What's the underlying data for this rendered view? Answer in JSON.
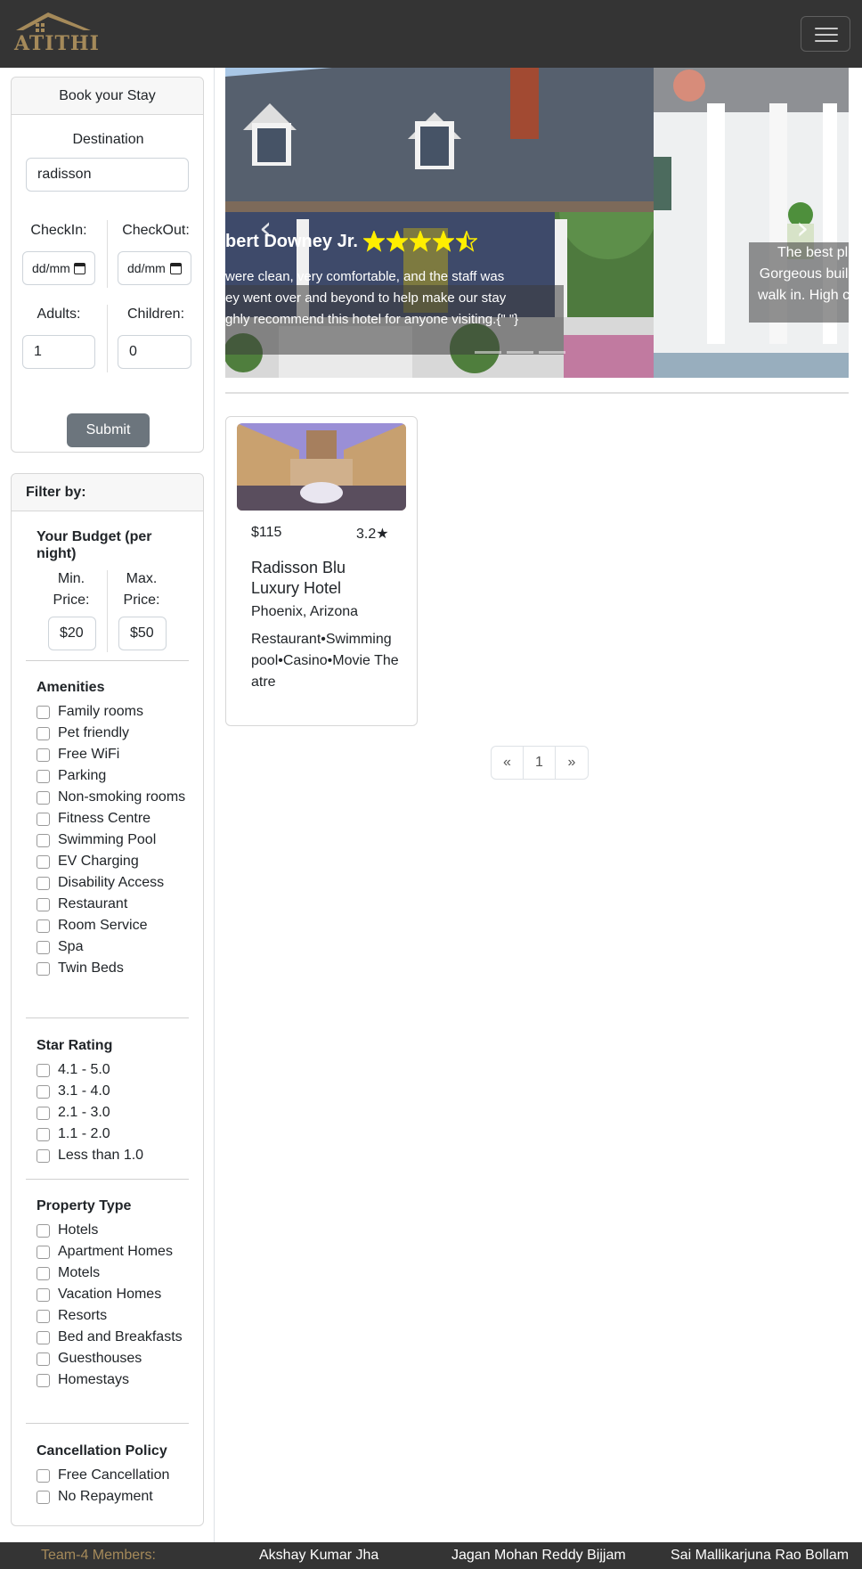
{
  "brand": {
    "name": "ATITHI"
  },
  "colors": {
    "navbar": "#343434",
    "brand_gold": "#a58a5a",
    "submit": "#6c757d",
    "star_yellow": "#ffee00"
  },
  "nav": {
    "menu_icon": "hamburger-icon"
  },
  "booking": {
    "title": "Book your Stay",
    "destination_label": "Destination",
    "destination_value": "radisson",
    "checkin_label": "CheckIn:",
    "checkout_label": "CheckOut:",
    "checkin_value": "dd/mm",
    "checkout_value": "dd/mm",
    "adults_label": "Adults:",
    "adults_value": "1",
    "children_label": "Children:",
    "children_value": "0",
    "submit_label": "Submit"
  },
  "filter": {
    "title": "Filter by:",
    "budget_title": "Your Budget (per night)",
    "min_label": "Min. Price:",
    "max_label": "Max. Price:",
    "min_value": "$20",
    "max_value": "$50",
    "amenities_title": "Amenities",
    "amenities": [
      "Family rooms",
      "Pet friendly",
      "Free WiFi",
      "Parking",
      "Non-smoking rooms",
      "Fitness Centre",
      "Swimming Pool",
      "EV Charging",
      "Disability Access",
      "Restaurant",
      "Room Service",
      "Spa",
      "Twin Beds"
    ],
    "star_title": "Star Rating",
    "stars": [
      "4.1 - 5.0",
      "3.1 - 4.0",
      "2.1 - 3.0",
      "1.1 - 2.0",
      "Less than 1.0"
    ],
    "property_title": "Property Type",
    "property": [
      "Hotels",
      "Apartment Homes",
      "Motels",
      "Vacation Homes",
      "Resorts",
      "Bed and Breakfasts",
      "Guesthouses",
      "Homestays"
    ],
    "cancel_title": "Cancellation Policy",
    "cancel": [
      "Free Cancellation",
      "No Repayment"
    ]
  },
  "carousel": {
    "slide1_name": "bert Downey Jr.",
    "slide1_rating": 4.5,
    "slide1_line1": "were clean, very comfortable, and the staff was",
    "slide1_line2": "ey went over and beyond to help make our stay",
    "slide1_line3": "ghly recommend this hotel for anyone visiting.{\" \"}",
    "slide2_line1": "The best pl",
    "slide2_line2": "Gorgeous buil",
    "slide2_line3": "walk in. High c",
    "prev_icon": "chevron-left-icon",
    "next_icon": "chevron-right-icon"
  },
  "hotel": {
    "price": "$115",
    "rating": "3.2",
    "name": "Radisson Blu Luxury Hotel",
    "location": "Phoenix, Arizona",
    "amenities": "Restaurant•Swimming pool•Casino•Movie Theatre"
  },
  "pagination": {
    "prev": "«",
    "page": "1",
    "next": "»"
  },
  "footer": {
    "label": "Team-4 Members:",
    "member1": "Akshay Kumar Jha",
    "member2": "Jagan Mohan Reddy Bijjam",
    "member3": "Sai Mallikarjuna Rao Bollam"
  }
}
